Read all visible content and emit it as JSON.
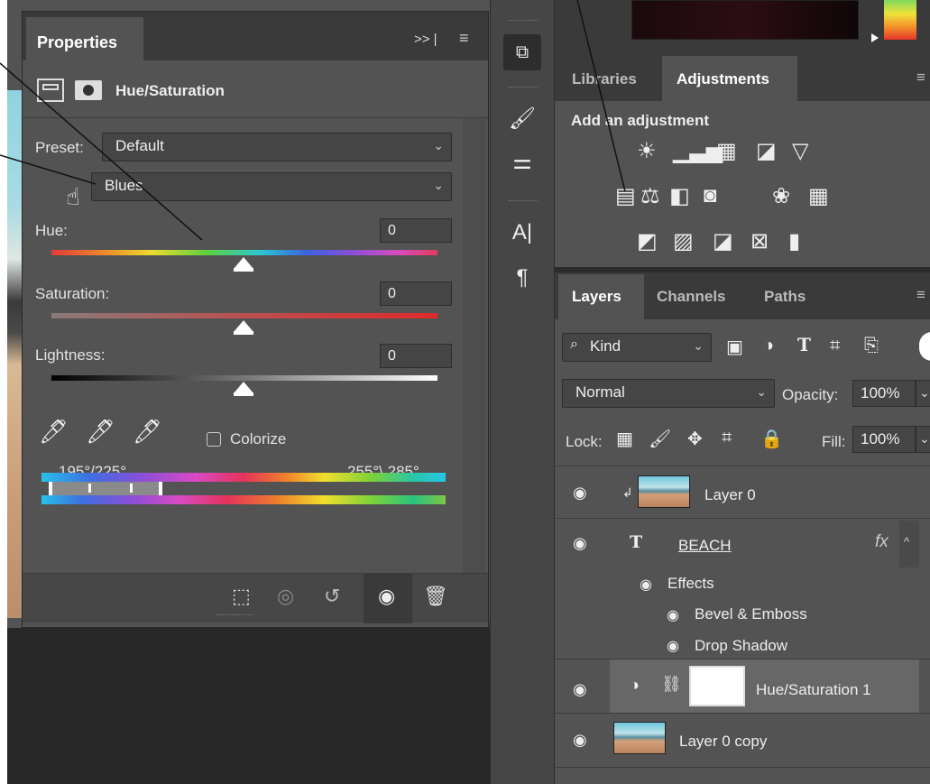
{
  "properties_panel": {
    "tab_label": "Properties",
    "collapse_label": ">> |",
    "menu_glyph": "≡",
    "title": "Hue/Saturation",
    "preset_label": "Preset:",
    "preset_value": "Default",
    "channel_value": "Blues",
    "hue_label": "Hue:",
    "hue_value": "0",
    "saturation_label": "Saturation:",
    "saturation_value": "0",
    "lightness_label": "Lightness:",
    "lightness_value": "0",
    "colorize_label": "Colorize",
    "range_left": "195°/225°",
    "range_right": "255°\\ 285°"
  },
  "toolstrip": {
    "tools": [
      "3d-tool",
      "brush-tool",
      "adjust-tool",
      "character-tool",
      "paragraph-tool"
    ]
  },
  "adjustments_panel": {
    "tab_libraries": "Libraries",
    "tab_adjustments": "Adjustments",
    "menu_glyph": "≡",
    "title": "Add an adjustment"
  },
  "layers_panel": {
    "tab_layers": "Layers",
    "tab_channels": "Channels",
    "tab_paths": "Paths",
    "menu_glyph": "≡",
    "filter_label": "Kind",
    "blend_mode": "Normal",
    "opacity_label": "Opacity:",
    "opacity_value": "100%",
    "lock_label": "Lock:",
    "fill_label": "Fill:",
    "fill_value": "100%",
    "layers": {
      "layer0": "Layer 0",
      "beach": "BEACH",
      "fx": "fx",
      "effects": "Effects",
      "bevel": "Bevel & Emboss",
      "drop_shadow": "Drop Shadow",
      "hue_sat": "Hue/Saturation 1",
      "layer0_copy": "Layer 0 copy"
    }
  },
  "colors": {
    "panel_bg": "#535353",
    "tab_bar_bg": "#3a3a3a",
    "selected_row_bg": "#676767",
    "saturation_track": "#e02a2a"
  }
}
